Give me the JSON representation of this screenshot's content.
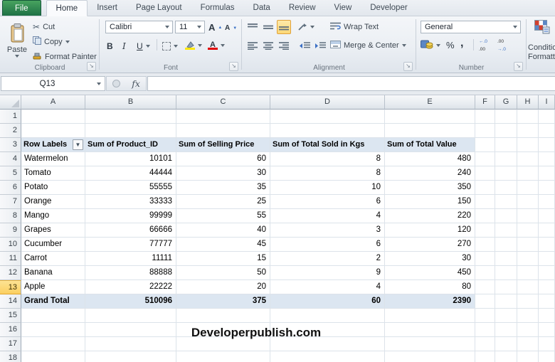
{
  "ribbon": {
    "tabs": {
      "file": "File",
      "items": [
        "Home",
        "Insert",
        "Page Layout",
        "Formulas",
        "Data",
        "Review",
        "View",
        "Developer"
      ],
      "active": "Home"
    },
    "clipboard": {
      "label": "Clipboard",
      "paste": "Paste",
      "cut": "Cut",
      "copy": "Copy",
      "format_painter": "Format Painter"
    },
    "font": {
      "label": "Font",
      "family": "Calibri",
      "size": "11",
      "bold": "B",
      "italic": "I",
      "underline": "U",
      "grow": "A",
      "shrink": "A"
    },
    "alignment": {
      "label": "Alignment",
      "wrap_text": "Wrap Text",
      "merge_center": "Merge & Center"
    },
    "number": {
      "label": "Number",
      "format": "General",
      "percent": "%",
      "comma": ",",
      "inc_decimal_top": "←.0",
      "inc_decimal_bottom": ".00",
      "dec_decimal_top": ".00",
      "dec_decimal_bottom": "→.0"
    },
    "styles": {
      "conditional_formatting_line1": "Conditional",
      "conditional_formatting_line2": "Formatting"
    }
  },
  "formula_bar": {
    "cell_ref": "Q13",
    "fx_label": "fx",
    "formula": ""
  },
  "sheet": {
    "columns": [
      "A",
      "B",
      "C",
      "D",
      "E",
      "F",
      "G",
      "H",
      "I"
    ],
    "visible_rows": 18,
    "active_row": 13,
    "pivot": {
      "header_row": 3,
      "headers": [
        "Row Labels",
        "Sum of Product_ID",
        "Sum of Selling Price",
        "Sum of Total Sold in Kgs",
        "Sum of Total Value"
      ],
      "filter_icon": "▼",
      "data_start_row": 4,
      "rows": [
        [
          "Watermelon",
          "10101",
          "60",
          "8",
          "480"
        ],
        [
          "Tomato",
          "44444",
          "30",
          "8",
          "240"
        ],
        [
          "Potato",
          "55555",
          "35",
          "10",
          "350"
        ],
        [
          "Orange",
          "33333",
          "25",
          "6",
          "150"
        ],
        [
          "Mango",
          "99999",
          "55",
          "4",
          "220"
        ],
        [
          "Grapes",
          "66666",
          "40",
          "3",
          "120"
        ],
        [
          "Cucumber",
          "77777",
          "45",
          "6",
          "270"
        ],
        [
          "Carrot",
          "11111",
          "15",
          "2",
          "30"
        ],
        [
          "Banana",
          "88888",
          "50",
          "9",
          "450"
        ],
        [
          "Apple",
          "22222",
          "20",
          "4",
          "80"
        ]
      ],
      "grand_total_row": 14,
      "grand_total": [
        "Grand Total",
        "510096",
        "375",
        "60",
        "2390"
      ]
    },
    "watermark": "Developerpublish.com"
  }
}
